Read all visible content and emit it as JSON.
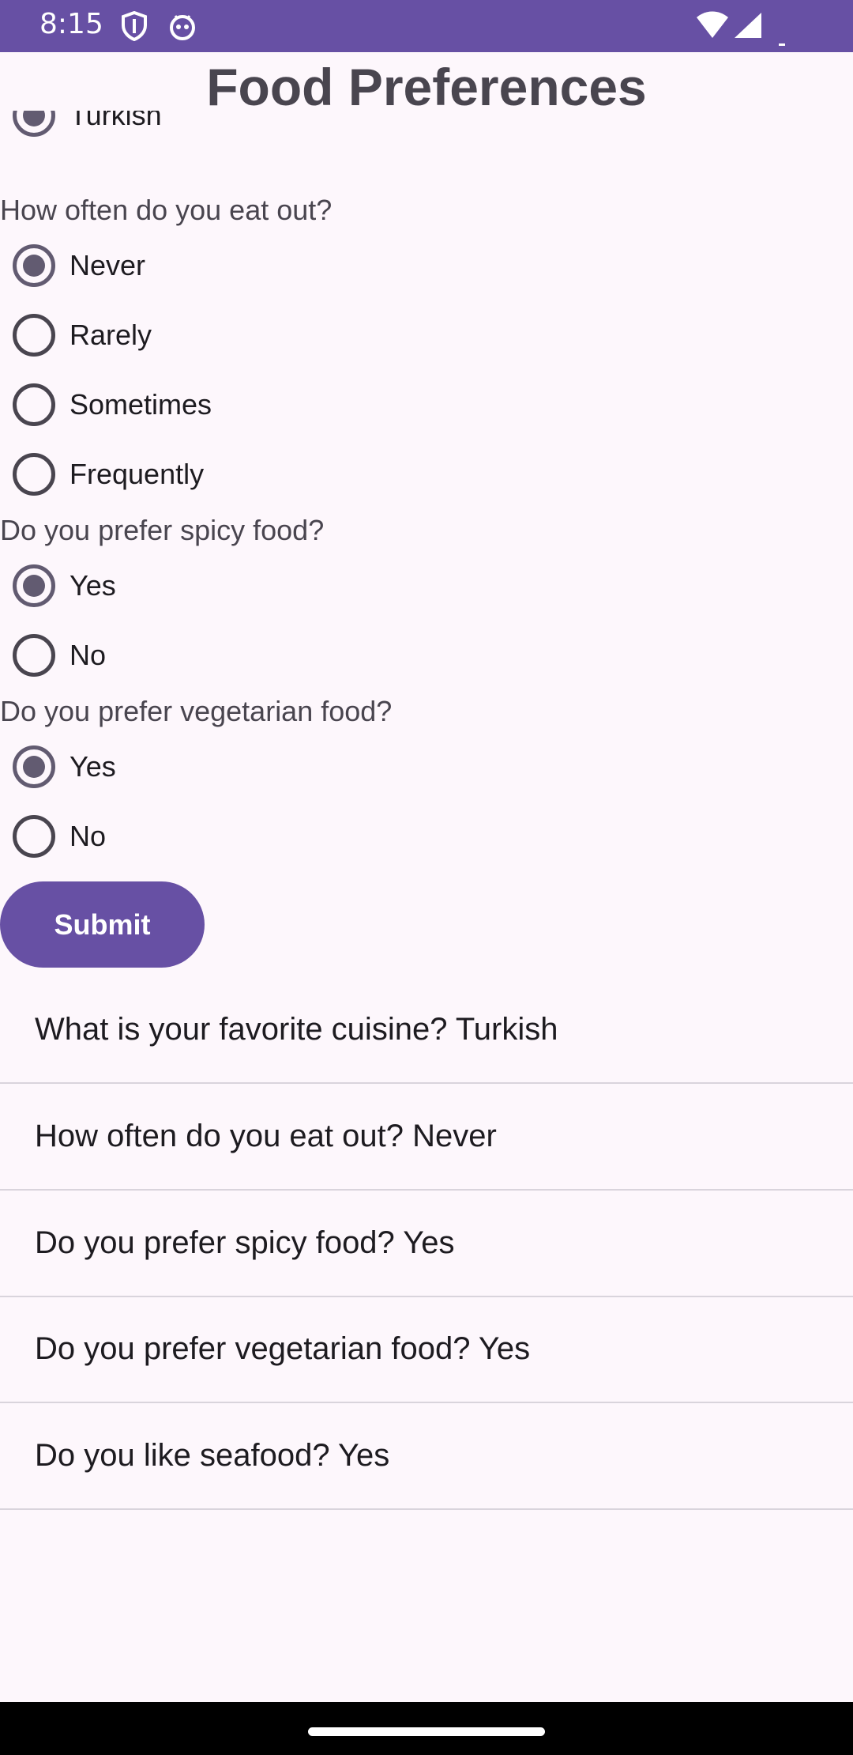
{
  "status_bar": {
    "time": "8:15",
    "color": "#6750a4"
  },
  "app": {
    "title": "Food Preferences"
  },
  "partial_option": {
    "label": "Turkish"
  },
  "questions": [
    {
      "text": "How often do you eat out?",
      "options": [
        "Never",
        "Rarely",
        "Sometimes",
        "Frequently"
      ],
      "selected": "Never"
    },
    {
      "text": "Do you prefer spicy food?",
      "options": [
        "Yes",
        "No"
      ],
      "selected": "Yes"
    },
    {
      "text": "Do you prefer vegetarian food?",
      "options": [
        "Yes",
        "No"
      ],
      "selected": "Yes"
    }
  ],
  "submit": {
    "label": "Submit"
  },
  "summary": [
    "What is your favorite cuisine? Turkish",
    "How often do you eat out? Never",
    "Do you prefer spicy food? Yes",
    "Do you prefer vegetarian food? Yes",
    "Do you like seafood? Yes"
  ],
  "colors": {
    "accent": "#6750a4",
    "radio_checked": "#625b71",
    "background": "#fdf7fc"
  }
}
